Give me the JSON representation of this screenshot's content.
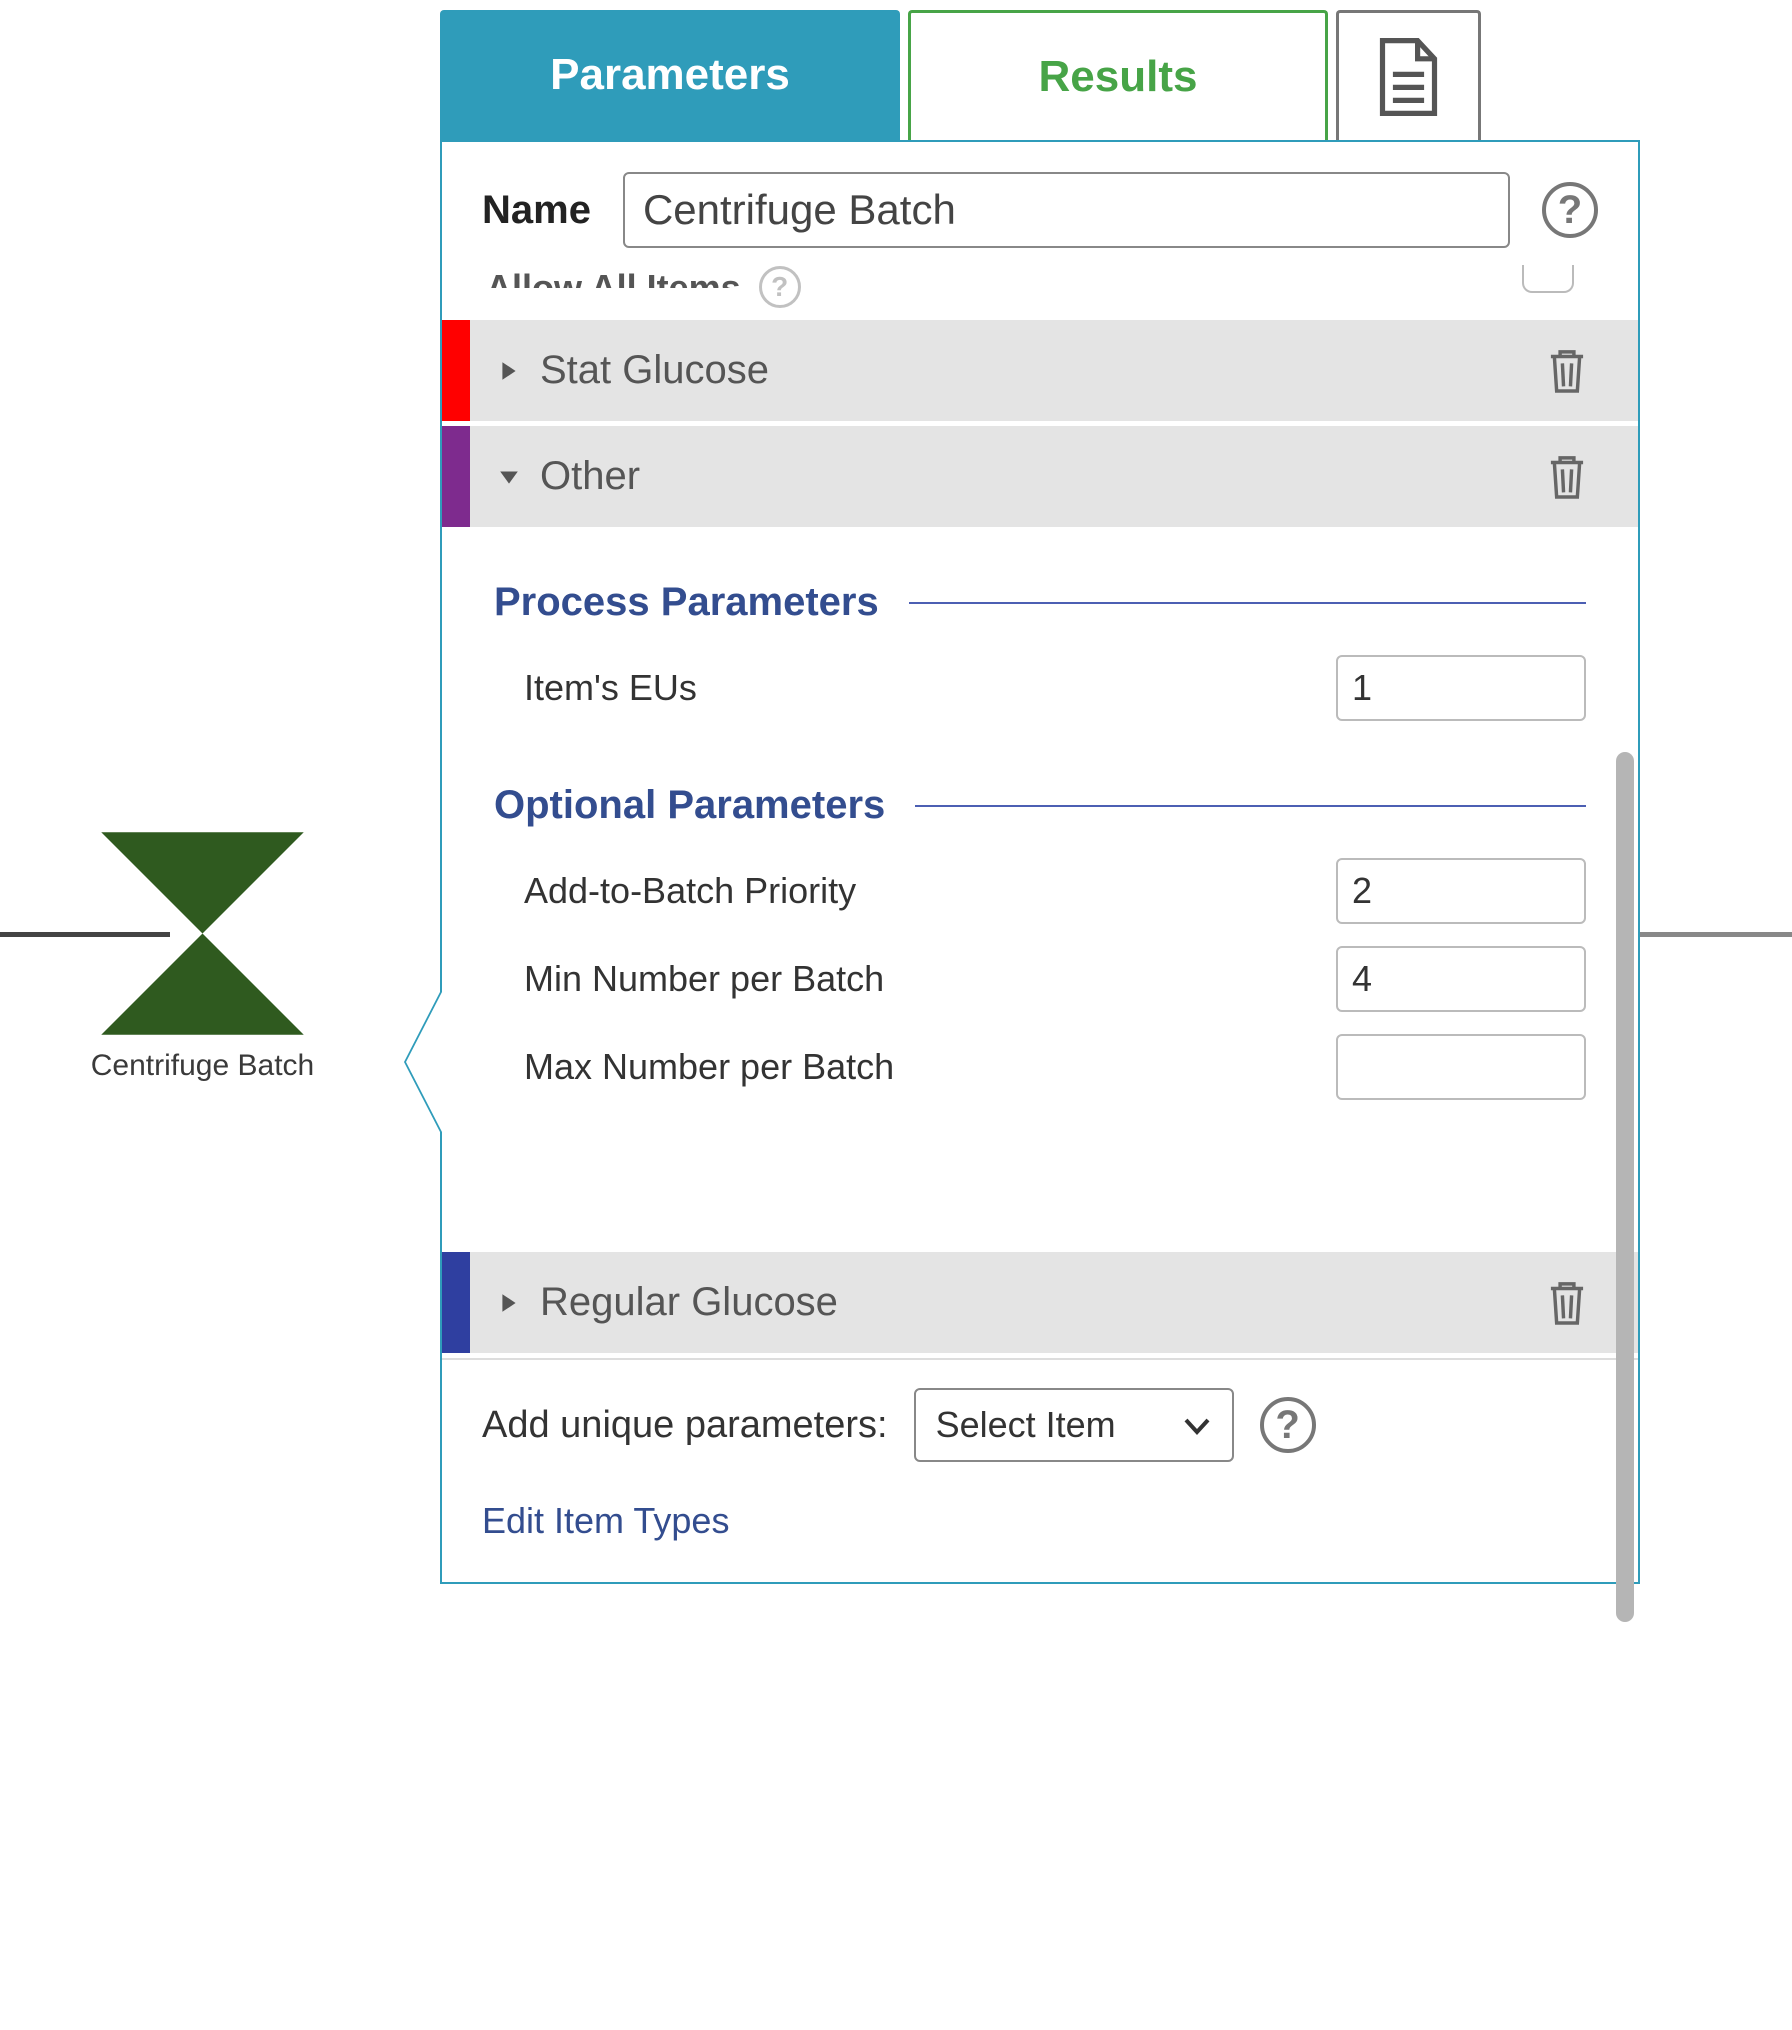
{
  "node": {
    "caption": "Centrifuge Batch"
  },
  "tabs": {
    "parameters": "Parameters",
    "results": "Results"
  },
  "name": {
    "label": "Name",
    "value": "Centrifuge Batch"
  },
  "allow_all_label": "Allow All Items",
  "items": {
    "stat_glucose": {
      "label": "Stat Glucose",
      "color": "#ff0000"
    },
    "other": {
      "label": "Other",
      "color": "#7e2b8e"
    },
    "regular_glucose": {
      "label": "Regular Glucose",
      "color": "#2f3fa0"
    }
  },
  "sections": {
    "process": {
      "title": "Process Parameters",
      "items_eus": {
        "label": "Item's EUs",
        "value": "1"
      }
    },
    "optional": {
      "title": "Optional Parameters",
      "add_to_batch_priority": {
        "label": "Add-to-Batch Priority",
        "value": "2"
      },
      "min_per_batch": {
        "label": "Min Number per Batch",
        "value": "4"
      },
      "max_per_batch": {
        "label": "Max Number per Batch",
        "value": ""
      }
    }
  },
  "bottom": {
    "add_label": "Add unique parameters:",
    "select_label": "Select Item",
    "edit_link": "Edit Item Types"
  }
}
